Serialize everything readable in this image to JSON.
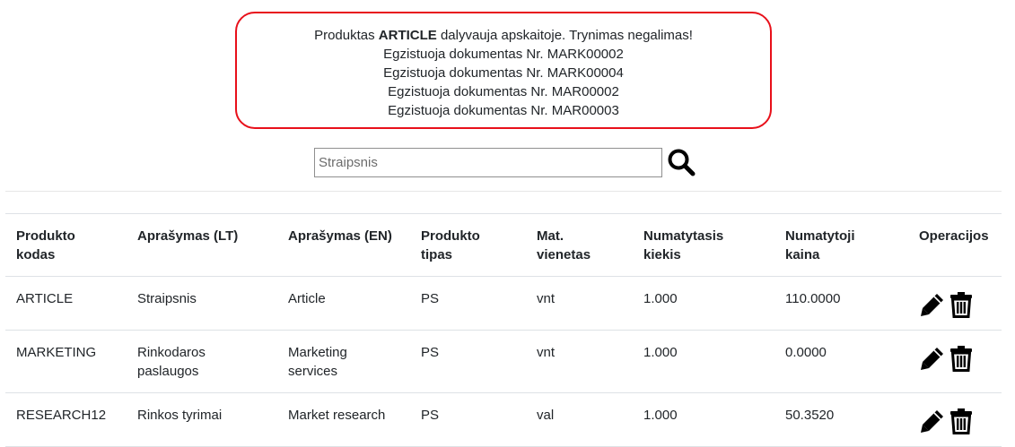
{
  "alert": {
    "prefix": "Produktas ",
    "product": "ARTICLE",
    "suffix": " dalyvauja apskaitoje. Trynimas negalimas!",
    "documents": [
      "Egzistuoja dokumentas Nr. MARK00002",
      "Egzistuoja dokumentas Nr. MARK00004",
      "Egzistuoja dokumentas Nr. MAR00002",
      "Egzistuoja dokumentas Nr. MAR00003"
    ]
  },
  "search": {
    "placeholder": "Straipsnis",
    "value": "",
    "icon": "search-icon"
  },
  "table": {
    "headers": {
      "code_1": "Produkto",
      "code_2": "kodas",
      "desc_lt": "Aprašymas (LT)",
      "desc_en": "Aprašymas (EN)",
      "type_1": "Produkto",
      "type_2": "tipas",
      "unit_1": "Mat.",
      "unit_2": "vienetas",
      "qty_1": "Numatytasis",
      "qty_2": "kiekis",
      "price_1": "Numatytoji",
      "price_2": "kaina",
      "ops": "Operacijos"
    },
    "rows": [
      {
        "code": "ARTICLE",
        "desc_lt_1": "Straipsnis",
        "desc_lt_2": "",
        "desc_en_1": "Article",
        "desc_en_2": "",
        "type": "PS",
        "unit": "vnt",
        "qty": "1.000",
        "price": "110.0000"
      },
      {
        "code": "MARKETING",
        "desc_lt_1": "Rinkodaros",
        "desc_lt_2": "paslaugos",
        "desc_en_1": "Marketing",
        "desc_en_2": "services",
        "type": "PS",
        "unit": "vnt",
        "qty": "1.000",
        "price": "0.0000"
      },
      {
        "code": "RESEARCH12",
        "desc_lt_1": "Rinkos tyrimai",
        "desc_lt_2": "",
        "desc_en_1": "Market research",
        "desc_en_2": "",
        "type": "PS",
        "unit": "val",
        "qty": "1.000",
        "price": "50.3520"
      }
    ]
  },
  "colors": {
    "alert_border": "#e8101a",
    "text": "#212529",
    "row_border": "#dee2e6"
  }
}
